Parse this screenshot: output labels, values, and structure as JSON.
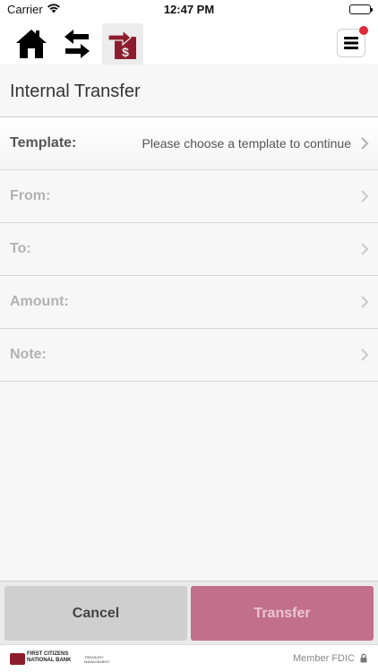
{
  "status_bar": {
    "carrier": "Carrier",
    "time": "12:47 PM",
    "battery_level": 1.0
  },
  "nav": {
    "tabs": [
      {
        "name": "home-icon",
        "active": false
      },
      {
        "name": "transfer-arrows-icon",
        "active": false
      },
      {
        "name": "internal-transfer-icon",
        "active": true
      }
    ],
    "menu_icon": "hamburger-menu-icon",
    "notification_badge": true,
    "accent_color": "#8c1d2d"
  },
  "page": {
    "title": "Internal Transfer"
  },
  "form": {
    "fields": [
      {
        "label": "Template:",
        "value": "Please choose a template to continue",
        "enabled": true
      },
      {
        "label": "From:",
        "value": "",
        "enabled": false
      },
      {
        "label": "To:",
        "value": "",
        "enabled": false
      },
      {
        "label": "Amount:",
        "value": "",
        "enabled": false
      },
      {
        "label": "Note:",
        "value": "",
        "enabled": false
      }
    ]
  },
  "actions": {
    "cancel_label": "Cancel",
    "transfer_label": "Transfer",
    "transfer_enabled": false
  },
  "footer": {
    "bank_name_line1": "FIRST CITIZENS",
    "bank_name_line2": "NATIONAL BANK",
    "bank_sub_line1": "TREASURY",
    "bank_sub_line2": "MANAGEMENT",
    "fdic_text": "Member FDIC"
  }
}
